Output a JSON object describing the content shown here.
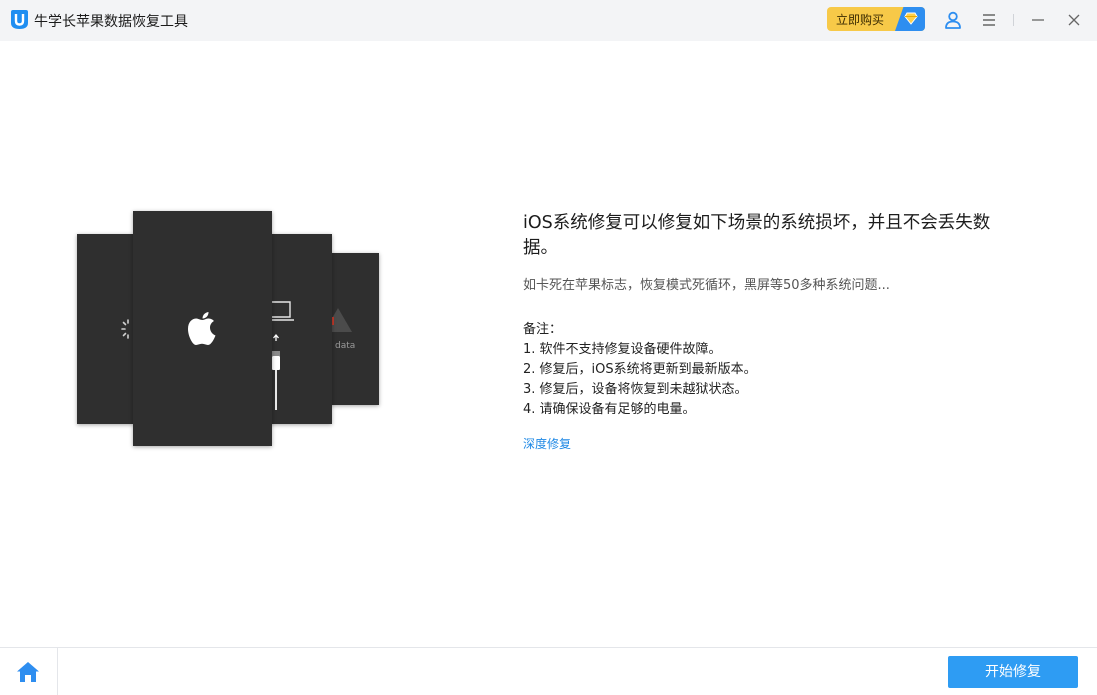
{
  "app": {
    "title": "牛学长苹果数据恢复工具",
    "buy_label": "立即购买",
    "icons": {
      "logo": "app-logo-icon",
      "user": "user-icon",
      "menu": "menu-icon",
      "minimize": "minimize-icon",
      "close": "close-icon",
      "home": "home-icon"
    }
  },
  "illustration": {
    "panel_text": "data"
  },
  "content": {
    "headline": "iOS系统修复可以修复如下场景的系统损坏，并且不会丢失数据。",
    "subtitle": "如卡死在苹果标志，恢复模式死循环，黑屏等50多种系统问题...",
    "notes_title": "备注：",
    "notes": [
      "1. 软件不支持修复设备硬件故障。",
      "2. 修复后，iOS系统将更新到最新版本。",
      "3. 修复后，设备将恢复到未越狱状态。",
      "4. 请确保设备有足够的电量。"
    ],
    "deep_repair_link": "深度修复"
  },
  "footer": {
    "start_button": "开始修复"
  },
  "colors": {
    "accent": "#2e9cf3",
    "buy_yellow": "#f7c948",
    "panel_dark": "#2f2f2f",
    "link": "#1e88e5"
  }
}
